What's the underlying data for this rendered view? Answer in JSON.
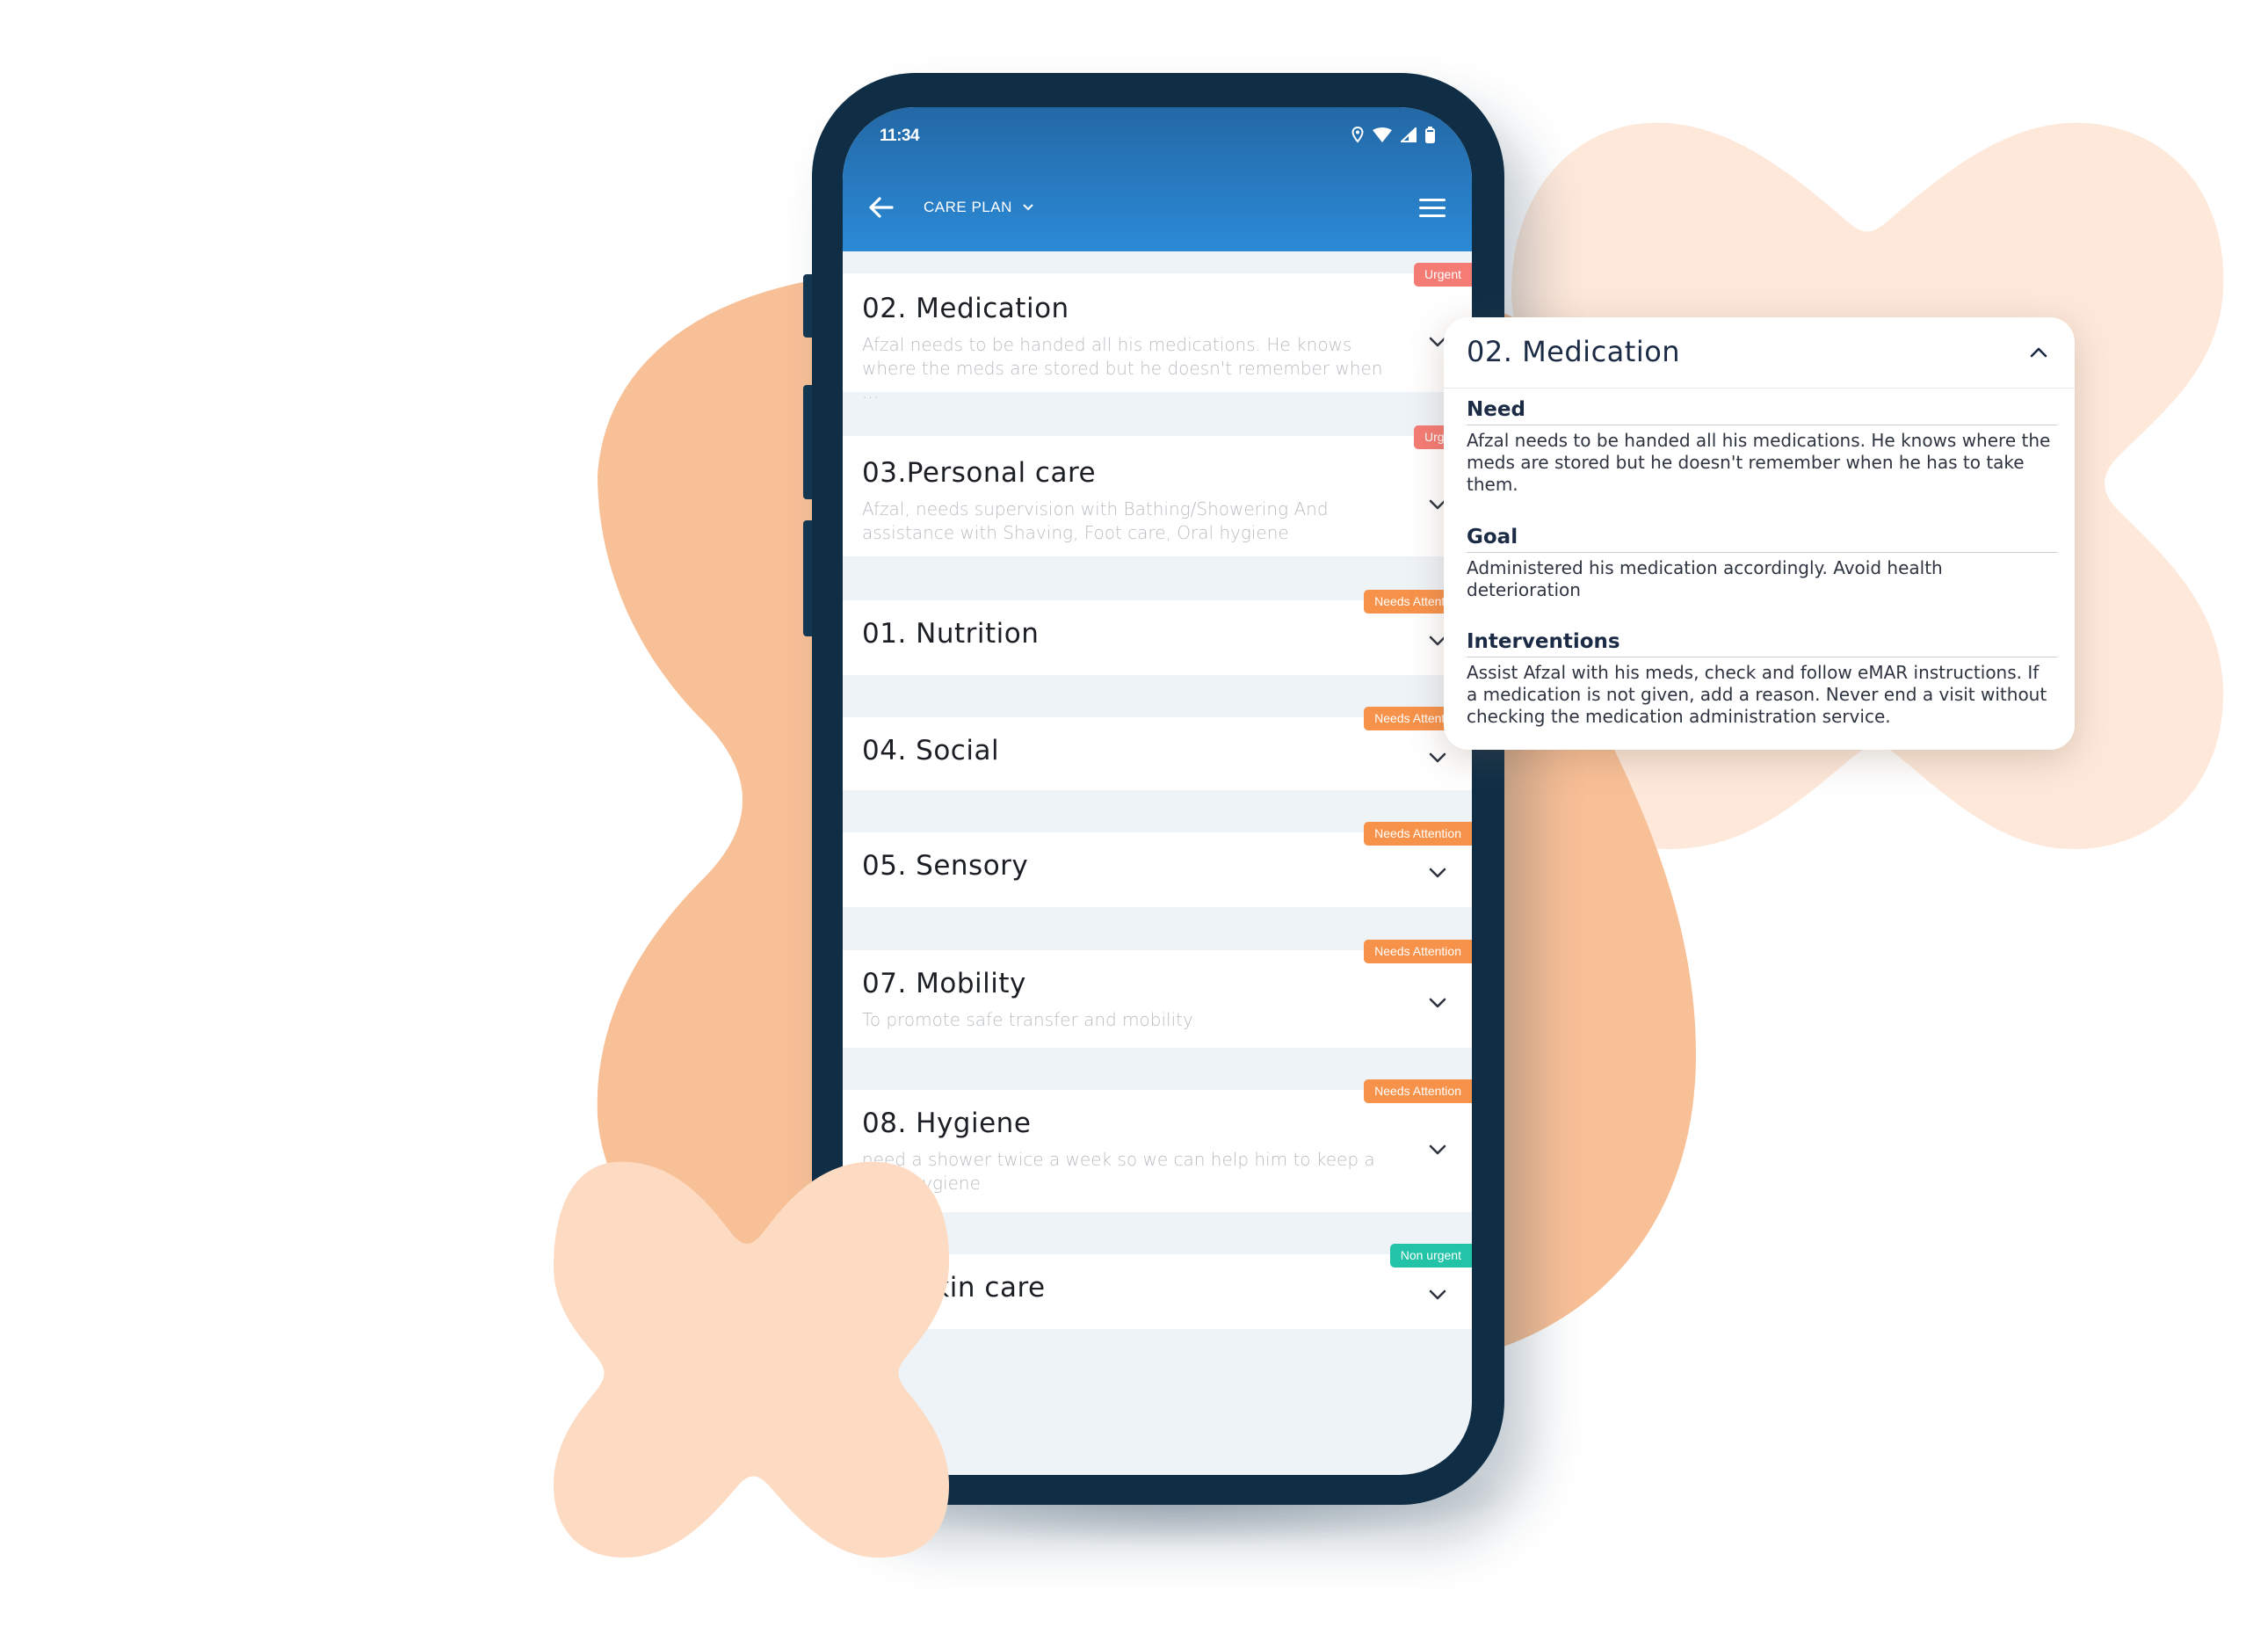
{
  "status_bar": {
    "time": "11:34",
    "icons": [
      "location-icon",
      "wifi-icon",
      "signal-icon",
      "battery-icon"
    ]
  },
  "app_bar": {
    "title": "CARE PLAN",
    "back_icon": "arrow-left-icon",
    "dropdown_icon": "chevron-down-icon",
    "menu_icon": "hamburger-menu-icon"
  },
  "colors": {
    "urgent": "#f47c74",
    "needs_attention": "#f7924a",
    "non_urgent": "#22c3a6",
    "app_bar": "#2b8ad6",
    "phone_frame": "#0f2e46"
  },
  "care_plan_items": [
    {
      "title": "02. Medication",
      "description": "Afzal needs to be handed all his medications. He knows where the meds are stored but he doesn't remember when ...",
      "badge": "Urgent",
      "badge_type": "urgent"
    },
    {
      "title": "03.Personal care",
      "description": "Afzal, needs supervision with Bathing/Showering And assistance with Shaving, Foot care, Oral hygiene",
      "badge": "Urgent",
      "badge_type": "urgent"
    },
    {
      "title": "01. Nutrition",
      "description": "",
      "badge": "Needs Attention",
      "badge_type": "needs_attention"
    },
    {
      "title": "04. Social",
      "description": "",
      "badge": "Needs Attention",
      "badge_type": "needs_attention"
    },
    {
      "title": "05. Sensory",
      "description": "",
      "badge": "Needs Attention",
      "badge_type": "needs_attention"
    },
    {
      "title": "07. Mobility",
      "description": "To promote safe transfer and mobility",
      "badge": "Needs Attention",
      "badge_type": "needs_attention"
    },
    {
      "title": "08. Hygiene",
      "description": "need a shower twice a week so we can help him to keep a good hygiene",
      "badge": "Needs Attention",
      "badge_type": "needs_attention"
    },
    {
      "title": "06. Skin care",
      "description": "",
      "badge": "Non urgent",
      "badge_type": "non_urgent"
    }
  ],
  "detail_popup": {
    "title": "02. Medication",
    "collapse_icon": "chevron-up-icon",
    "sections": [
      {
        "heading": "Need",
        "body": "Afzal needs to be handed all his medications. He knows where the meds are stored but he doesn't remember when he has to take them."
      },
      {
        "heading": "Goal",
        "body": "Administered his medication accordingly. Avoid health deterioration"
      },
      {
        "heading": "Interventions",
        "body": "Assist Afzal with his meds, check and follow eMAR instructions. If a medication is not given, add a reason. Never end a visit without checking the medication administration service."
      }
    ]
  }
}
